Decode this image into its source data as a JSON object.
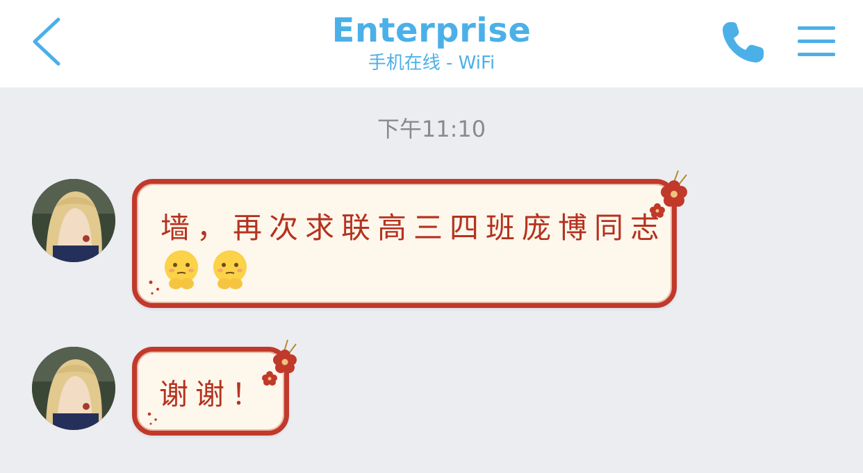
{
  "header": {
    "title": "Enterprise",
    "status": "手机在线 - WiFi",
    "back_icon": "chevron-left-icon",
    "call_icon": "phone-icon",
    "menu_icon": "hamburger-menu-icon",
    "accent": "#4bb0e8"
  },
  "chat": {
    "timestamp": "下午11:10",
    "messages": [
      {
        "text": "墙，再次求联高三四班庞博同志",
        "emojis": [
          "thinking-emoji",
          "thinking-emoji"
        ]
      },
      {
        "text": "谢谢！"
      }
    ]
  },
  "theme": {
    "bubble_border": "#c0392b",
    "bubble_fill": "#fdf7ec",
    "bubble_text": "#b5321f"
  }
}
